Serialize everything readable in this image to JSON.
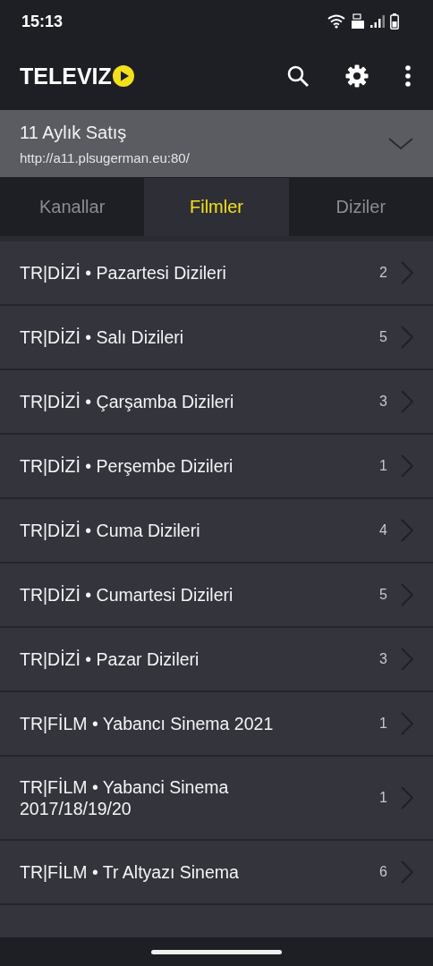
{
  "status_bar": {
    "time": "15:13"
  },
  "app_bar": {
    "logo_text": "TELEVIZ"
  },
  "server": {
    "name": "11 Aylık Satış",
    "url": "http://a11.plsugerman.eu:80/"
  },
  "tabs": [
    {
      "label": "Kanallar",
      "selected": false
    },
    {
      "label": "Filmler",
      "selected": true
    },
    {
      "label": "Diziler",
      "selected": false
    }
  ],
  "categories": [
    {
      "title": "TR|DİZİ • Pazartesi Dizileri",
      "count": "2"
    },
    {
      "title": "TR|DİZİ • Salı Dizileri",
      "count": "5"
    },
    {
      "title": "TR|DİZİ • Çarşamba Dizileri",
      "count": "3"
    },
    {
      "title": "TR|DİZİ • Perşembe Dizileri",
      "count": "1"
    },
    {
      "title": "TR|DİZİ • Cuma Dizileri",
      "count": "4"
    },
    {
      "title": "TR|DİZİ • Cumartesi Dizileri",
      "count": "5"
    },
    {
      "title": "TR|DİZİ • Pazar Dizileri",
      "count": "3"
    },
    {
      "title": "TR|FİLM • Yabancı Sinema 2021",
      "count": "1"
    },
    {
      "title": "TR|FİLM • Yabanci Sinema 2017/18/19/20",
      "count": "1"
    },
    {
      "title": "TR|FİLM • Tr Altyazı Sinema",
      "count": "6"
    }
  ]
}
